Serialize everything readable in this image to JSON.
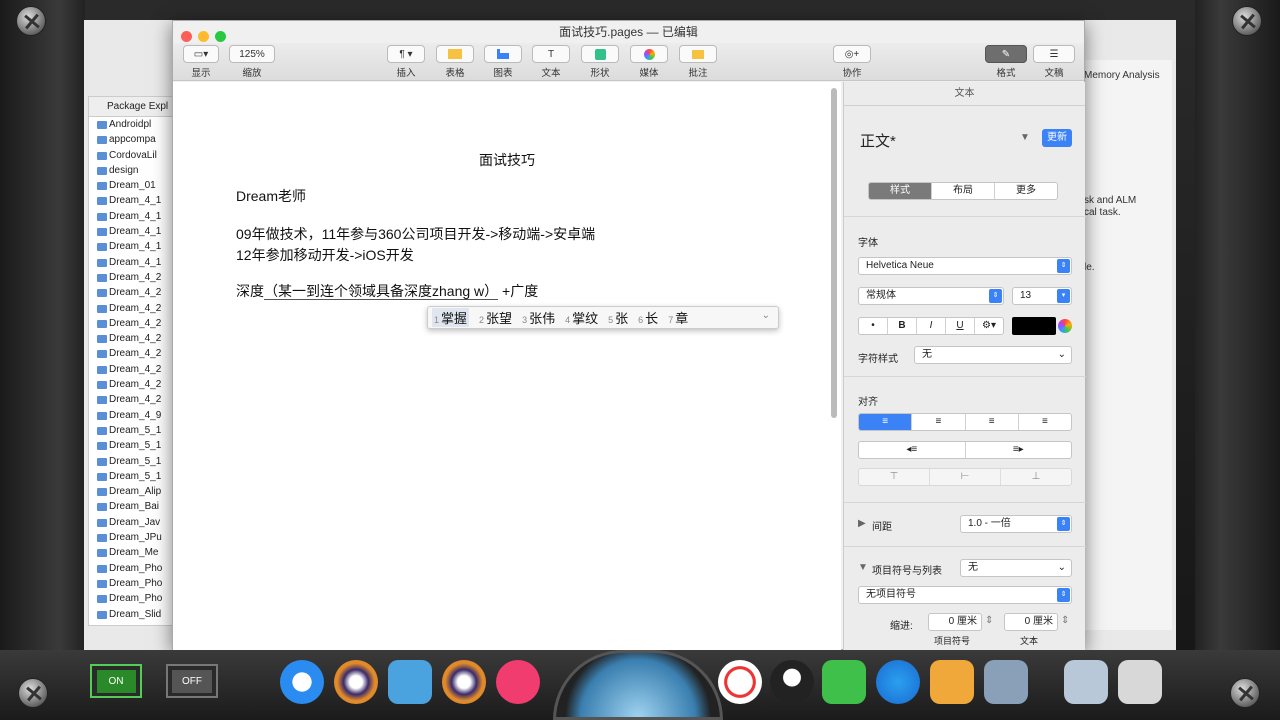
{
  "pages": {
    "window_title": "面试技巧.pages — 已编辑",
    "toolbar": {
      "view": "显示",
      "zoom_value": "125%",
      "zoom": "缩放",
      "insert": "插入",
      "table": "表格",
      "chart": "图表",
      "text": "文本",
      "shape": "形状",
      "media": "媒体",
      "comment": "批注",
      "collaborate": "协作",
      "format": "格式",
      "document": "文稿"
    },
    "document": {
      "title": "面试技巧",
      "author": "Dream老师",
      "line1": "09年做技术，11年参与360公司项目开发->移动端->安卓端",
      "line2": "12年参加移动开发->iOS开发",
      "line3_prefix": "深度",
      "line3_paren": "（某一到连个领域具备深度zhang w）",
      "line3_suffix": "+广度"
    },
    "ime_candidates": [
      {
        "n": "1",
        "text": "掌握"
      },
      {
        "n": "2",
        "text": "张望"
      },
      {
        "n": "3",
        "text": "张伟"
      },
      {
        "n": "4",
        "text": "掌纹"
      },
      {
        "n": "5",
        "text": "张"
      },
      {
        "n": "6",
        "text": "长"
      },
      {
        "n": "7",
        "text": "章"
      }
    ],
    "inspector": {
      "header": "文本",
      "style_name": "正文*",
      "update": "更新",
      "tab_style": "样式",
      "tab_layout": "布局",
      "tab_more": "更多",
      "font_label": "字体",
      "font_family": "Helvetica Neue",
      "font_weight": "常规体",
      "font_size": "13",
      "bold": "B",
      "italic": "I",
      "underline": "U",
      "char_style_label": "字符样式",
      "char_style_value": "无",
      "align_label": "对齐",
      "spacing_label": "间距",
      "spacing_value": "1.0 - 一倍",
      "bullets_label": "项目符号与列表",
      "bullets_value": "无",
      "bullets_preset": "无项目符号",
      "indent_label": "缩进:",
      "indent_bullet_value": "0 厘米",
      "indent_text_value": "0 厘米",
      "indent_bullet_caption": "项目符号",
      "indent_text_caption": "文本"
    }
  },
  "eclipse": {
    "package_explorer_title": "Package Expl",
    "items": [
      "Androidpl",
      "appcompa",
      "CordovaLil",
      "design",
      "Dream_01",
      "Dream_4_1",
      "Dream_4_1",
      "Dream_4_1",
      "Dream_4_1",
      "Dream_4_1",
      "Dream_4_2",
      "Dream_4_2",
      "Dream_4_2",
      "Dream_4_2",
      "Dream_4_2",
      "Dream_4_2",
      "Dream_4_2",
      "Dream_4_2",
      "Dream_4_2",
      "Dream_4_9",
      "Dream_5_1",
      "Dream_5_1",
      "Dream_5_1",
      "Dream_5_1",
      "Dream_Alip",
      "Dream_Bai",
      "Dream_Jav",
      "Dream_JPu",
      "Dream_Me",
      "Dream_Pho",
      "Dream_Pho",
      "Dream_Pho",
      "Dream_Slid"
    ],
    "memory_analysis": "Memory Analysis",
    "task_line1": "sk and ALM",
    "task_line2": "cal task.",
    "side_text": "le."
  },
  "dock": {
    "switch_on": "ON",
    "switch_off": "OFF"
  }
}
